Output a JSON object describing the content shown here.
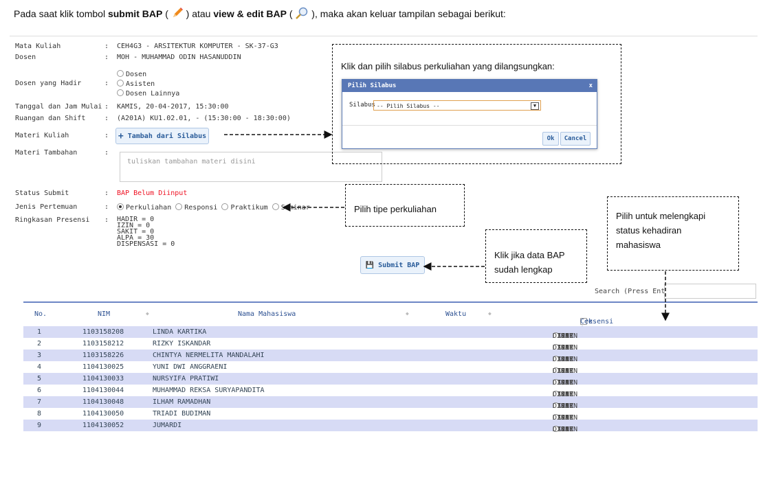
{
  "intro": {
    "part1": "Pada saat klik tombol ",
    "submit_bap": "submit BAP",
    "part2": " ( ",
    "part3": " ) atau ",
    "view_edit": "view & edit BAP",
    "part4": " ( ",
    "part5": " ), maka akan keluar tampilan sebagai berikut:"
  },
  "form": {
    "mata_kuliah": {
      "label": "Mata Kuliah",
      "value": "CEH4G3 - ARSITEKTUR KOMPUTER - SK-37-G3"
    },
    "dosen": {
      "label": "Dosen",
      "value": "MOH - MUHAMMAD ODIN HASANUDDIN"
    },
    "dosen_hadir": {
      "label": "Dosen yang Hadir",
      "options": [
        "Dosen",
        "Asisten",
        "Dosen Lainnya"
      ]
    },
    "tanggal": {
      "label": "Tanggal dan Jam Mulai",
      "value": "KAMIS, 20-04-2017, 15:30:00"
    },
    "ruangan": {
      "label": "Ruangan dan Shift",
      "value": "(A201A) KU1.02.01, - (15:30:00 - 18:30:00)"
    },
    "materi": {
      "label": "Materi Kuliah",
      "button": "Tambah dari Silabus"
    },
    "materi_tambahan": {
      "label": "Materi Tambahan",
      "placeholder": "tuliskan tambahan materi disini"
    },
    "status": {
      "label": "Status Submit",
      "value": "BAP Belum Diinput"
    },
    "jenis": {
      "label": "Jenis Pertemuan",
      "options": [
        "Perkuliahan",
        "Responsi",
        "Praktikum",
        "Seminar"
      ],
      "selected": "Perkuliahan"
    },
    "ringkasan": {
      "label": "Ringkasan Presensi",
      "lines": [
        "HADIR = 0",
        "IZIN = 0",
        "SAKIT = 0",
        "ALPA = 30",
        "DISPENSASI = 0"
      ]
    },
    "colon": ":"
  },
  "submit_button": "Submit BAP",
  "search": {
    "label": "Search (Press Enter):"
  },
  "table": {
    "headers": {
      "no": "No.",
      "nim": "NIM",
      "nama": "Nama Mahasiswa",
      "waktu": "Waktu",
      "presensi": "Presensi |",
      "cek": "Cek Semua Hadir"
    },
    "options": [
      "HADIR",
      "IZIN",
      "SAKIT",
      "ALPA",
      "DISPEN"
    ],
    "selected": "ALPA",
    "rows": [
      {
        "no": "1",
        "nim": "1103158208",
        "nama": "LINDA KARTIKA"
      },
      {
        "no": "2",
        "nim": "1103158212",
        "nama": "RIZKY ISKANDAR"
      },
      {
        "no": "3",
        "nim": "1103158226",
        "nama": "CHINTYA NERMELITA MANDALAHI"
      },
      {
        "no": "4",
        "nim": "1104130025",
        "nama": "YUNI DWI ANGGRAENI"
      },
      {
        "no": "5",
        "nim": "1104130033",
        "nama": "NURSYIFA PRATIWI"
      },
      {
        "no": "6",
        "nim": "1104130044",
        "nama": "MUHAMMAD REKSA SURYAPANDITA"
      },
      {
        "no": "7",
        "nim": "1104130048",
        "nama": "ILHAM RAMADHAN"
      },
      {
        "no": "8",
        "nim": "1104130050",
        "nama": "TRIADI BUDIMAN"
      },
      {
        "no": "9",
        "nim": "1104130052",
        "nama": "JUMARDI"
      }
    ]
  },
  "callouts": {
    "silabus": "Klik dan pilih silabus perkuliahan yang dilangsungkan:",
    "tipe": "Pilih tipe perkuliahan",
    "submit": [
      "Klik jika data BAP",
      "sudah lengkap"
    ],
    "presensi": [
      "Pilih untuk melengkapi",
      "status kehadiran",
      "mahasiswa"
    ]
  },
  "dialog": {
    "title": "Pilih Silabus",
    "close": "x",
    "field_label": "Silabus",
    "select_value": "-- Pilih Silabus --",
    "ok": "Ok",
    "cancel": "Cancel"
  },
  "colors": {
    "accent": "#5877b6",
    "row_odd": "#d7dbf5",
    "status_red": "#e12"
  },
  "icons": [
    "pencil-icon",
    "magnifier-icon",
    "plus-icon",
    "save-icon",
    "sort-icon",
    "dropdown-icon"
  ]
}
